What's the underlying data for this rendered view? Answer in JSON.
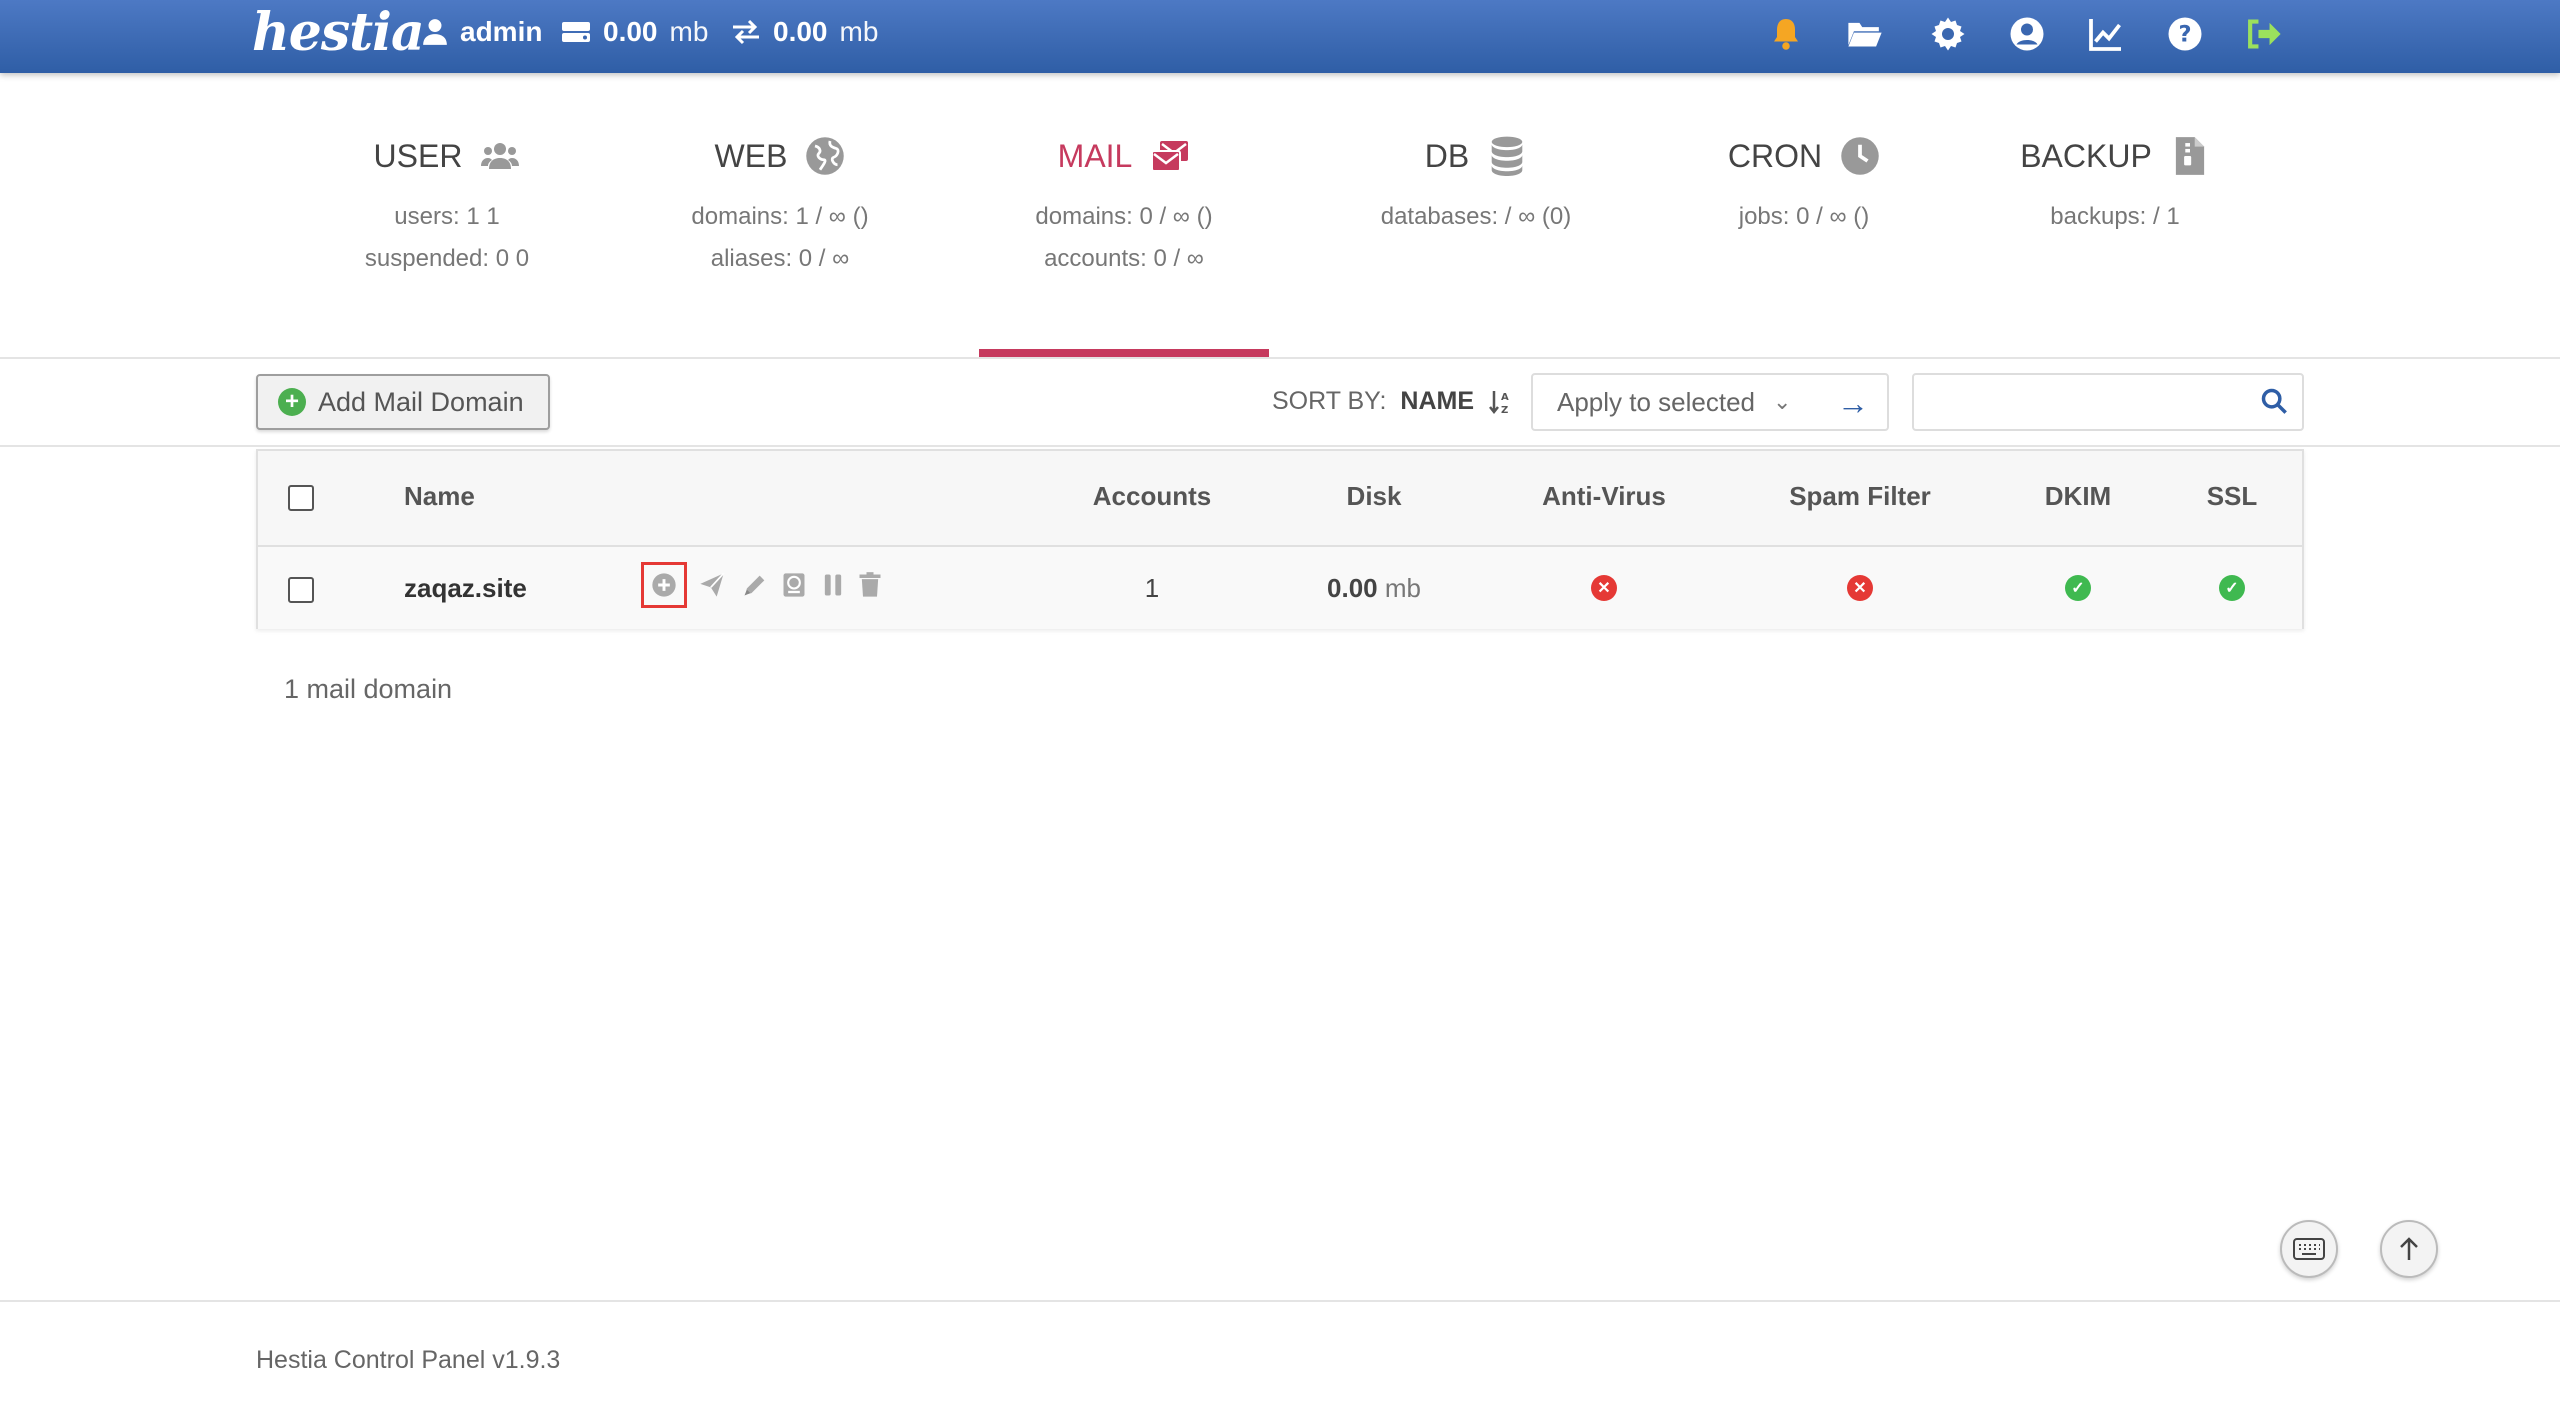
{
  "topbar": {
    "logo": "hestia",
    "user": "admin",
    "disk": {
      "value": "0.00",
      "unit": "mb"
    },
    "bandwidth": {
      "value": "0.00",
      "unit": "mb"
    },
    "icons": [
      "bell-icon",
      "folder-icon",
      "gear-icon",
      "user-circle-icon",
      "chart-icon",
      "help-icon",
      "logout-icon"
    ],
    "bell_color": "#f5a623",
    "logout_color": "#9be15d"
  },
  "tabs": [
    {
      "title": "USER",
      "icon": "users-icon",
      "lines": [
        "users: 1 1",
        "suspended: 0 0"
      ]
    },
    {
      "title": "WEB",
      "icon": "globe-icon",
      "lines": [
        "domains: 1 / ∞ ()",
        "aliases: 0 / ∞"
      ]
    },
    {
      "title": "MAIL",
      "icon": "mail-icon",
      "lines": [
        "domains: 0 / ∞ ()",
        "accounts: 0 / ∞"
      ],
      "active": true
    },
    {
      "title": "DB",
      "icon": "database-icon",
      "lines": [
        "databases: / ∞ (0)"
      ]
    },
    {
      "title": "CRON",
      "icon": "clock-icon",
      "lines": [
        "jobs: 0 / ∞ ()"
      ]
    },
    {
      "title": "BACKUP",
      "icon": "file-archive-icon",
      "lines": [
        "backups: / 1"
      ]
    }
  ],
  "accent_color": "#c63a5e",
  "toolbar": {
    "add_label": "Add Mail Domain",
    "sort_label": "SORT BY:",
    "sort_value": "NAME",
    "apply_label": "Apply to selected",
    "search_placeholder": ""
  },
  "table": {
    "headers": [
      "Name",
      "Accounts",
      "Disk",
      "Anti-Virus",
      "Spam Filter",
      "DKIM",
      "SSL"
    ],
    "rows": [
      {
        "name": "zaqaz.site",
        "accounts": "1",
        "disk_value": "0.00",
        "disk_unit": "mb",
        "antivirus": false,
        "spam_filter": false,
        "dkim": true,
        "ssl": true,
        "actions": [
          "add-account-icon",
          "send-icon",
          "edit-icon",
          "dns-icon",
          "suspend-icon",
          "delete-icon"
        ]
      }
    ]
  },
  "count_label": "1 mail domain",
  "footer": "Hestia Control Panel v1.9.3"
}
